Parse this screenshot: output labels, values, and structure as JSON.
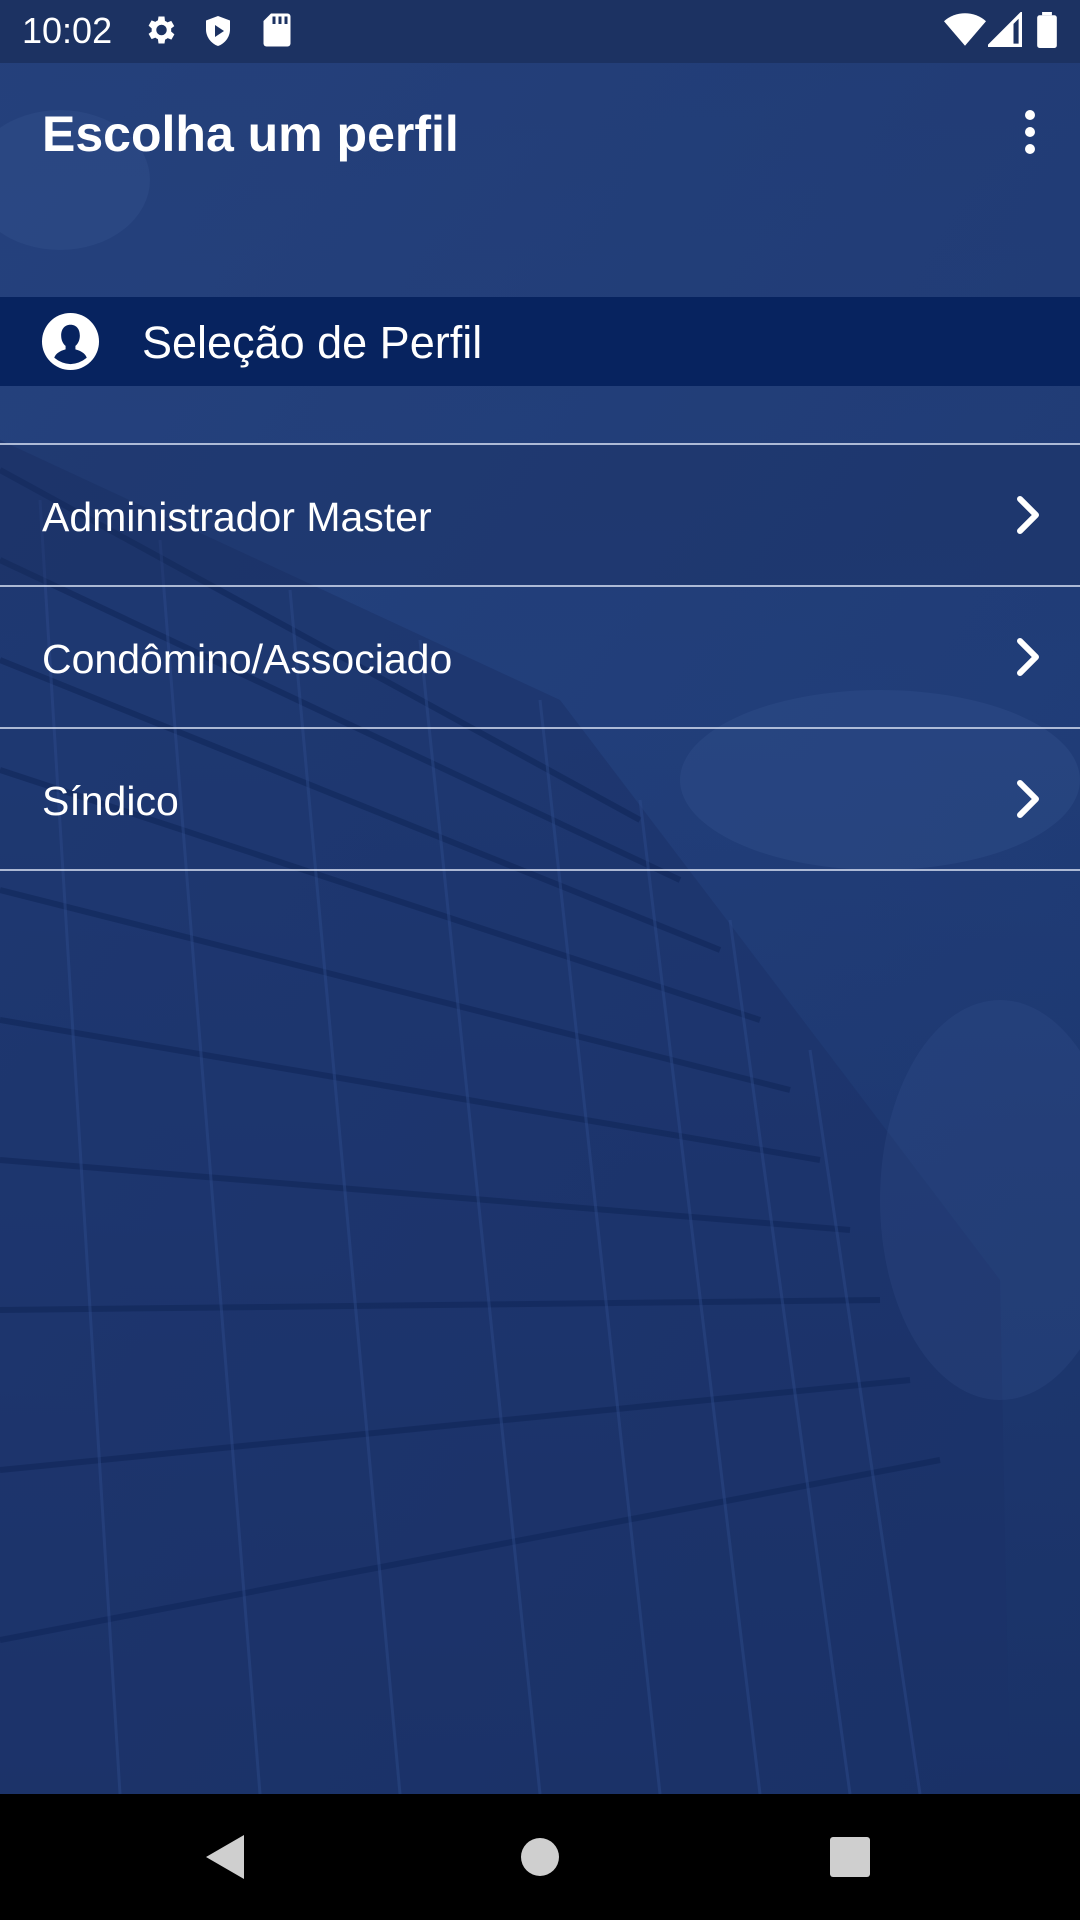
{
  "status_bar": {
    "time": "10:02",
    "left_icons": [
      "settings-icon",
      "shield-icon",
      "sd-card-icon"
    ],
    "right_icons": [
      "wifi-icon",
      "cellular-signal-icon",
      "battery-icon"
    ]
  },
  "app_bar": {
    "title": "Escolha um perfil",
    "menu_icon": "more-vert-icon"
  },
  "section": {
    "icon": "user-avatar-icon",
    "title": "Seleção de Perfil"
  },
  "profiles": [
    {
      "label": "Administrador Master",
      "icon": "chevron-right-icon"
    },
    {
      "label": "Condômino/Associado",
      "icon": "chevron-right-icon"
    },
    {
      "label": "Síndico",
      "icon": "chevron-right-icon"
    }
  ],
  "nav_bar": {
    "buttons": [
      "back-icon",
      "home-icon",
      "recents-icon"
    ]
  },
  "colors": {
    "status_bar": "#1c3262",
    "background": "#23407c",
    "section_header": "#07235f",
    "text": "#ffffff",
    "nav_bar": "#000000"
  }
}
